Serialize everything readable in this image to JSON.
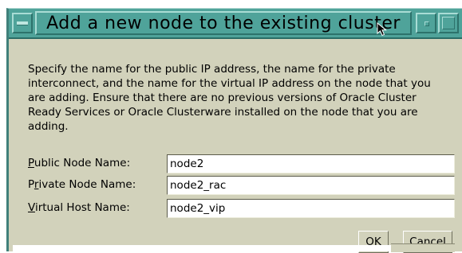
{
  "window": {
    "title": "Add a new node to the existing cluster",
    "icons": {
      "system_menu": "window-menu-icon",
      "minimize": "minimize-icon",
      "maximize": "maximize-icon",
      "cursor": "mouse-pointer-icon"
    },
    "colors": {
      "titlebar": "#4fa39a",
      "body": "#d2d2bb"
    }
  },
  "dialog": {
    "description": "Specify the name for the public IP address, the name for the private interconnect, and the name for the virtual IP address on the node that you are adding.  Ensure that there are no previous versions of Oracle Cluster Ready Services or Oracle Clusterware installed on the node that you are adding.",
    "fields": {
      "public": {
        "label_mnemonic": "P",
        "label_rest": "ublic Node Name:",
        "value": "node2"
      },
      "private": {
        "label_before": "P",
        "label_mnemonic": "r",
        "label_rest": "ivate Node Name:",
        "value": "node2_rac"
      },
      "virtual": {
        "label_mnemonic": "V",
        "label_rest": "irtual Host Name:",
        "value": "node2_vip"
      }
    },
    "buttons": {
      "ok": {
        "mnemonic": "O",
        "rest": "K"
      },
      "cancel": {
        "mnemonic": "C",
        "rest": "ancel"
      }
    }
  }
}
